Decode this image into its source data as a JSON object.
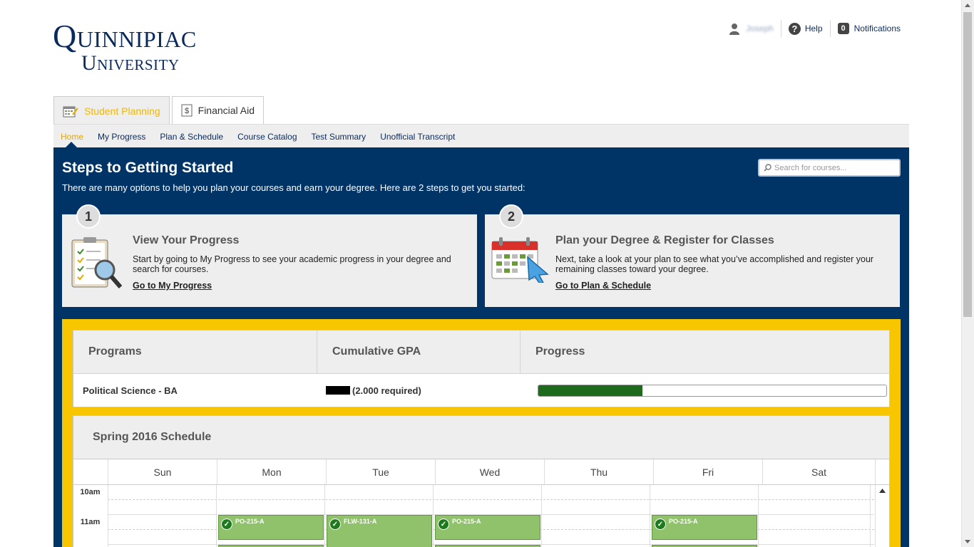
{
  "logo": {
    "line1": "Quinnipiac",
    "line2": "University"
  },
  "header": {
    "user_name": "Joseph",
    "help_label": "Help",
    "notifications_count": "0",
    "notifications_label": "Notifications"
  },
  "tabs": [
    {
      "label": "Student Planning",
      "active": true
    },
    {
      "label": "Financial Aid",
      "active": false
    }
  ],
  "subnav": [
    "Home",
    "My Progress",
    "Plan & Schedule",
    "Course Catalog",
    "Test Summary",
    "Unofficial Transcript"
  ],
  "steps": {
    "title": "Steps to Getting Started",
    "subtitle": "There are many options to help you plan your courses and earn your degree. Here are 2 steps to get you started:",
    "search_placeholder": "Search for courses...",
    "cards": [
      {
        "number": "1",
        "title": "View Your Progress",
        "text": "Start by going to My Progress to see your academic progress in your degree and search for courses.",
        "link": "Go to My Progress"
      },
      {
        "number": "2",
        "title": "Plan your Degree & Register for Classes",
        "text": "Next, take a look at your plan to see what you’ve accomplished and register your remaining classes toward your degree.",
        "link": "Go to Plan & Schedule"
      }
    ]
  },
  "programs": {
    "headers": [
      "Programs",
      "Cumulative GPA",
      "Progress"
    ],
    "rows": [
      {
        "program": "Political Science - BA",
        "gpa_required": "(2.000 required)",
        "progress_fraction": 0.3
      }
    ]
  },
  "schedule": {
    "title": "Spring 2016 Schedule",
    "days": [
      "Sun",
      "Mon",
      "Tue",
      "Wed",
      "Thu",
      "Fri",
      "Sat"
    ],
    "hours": [
      "10am",
      "11am"
    ],
    "events": [
      {
        "day_index": 1,
        "label": "PO-215-A"
      },
      {
        "day_index": 2,
        "label": "FLW-131-A"
      },
      {
        "day_index": 3,
        "label": "PO-215-A"
      },
      {
        "day_index": 5,
        "label": "PO-215-A"
      }
    ]
  },
  "colors": {
    "navy": "#003366",
    "gold": "#f7c600",
    "accent": "#e8a800",
    "event_green": "#90c26b",
    "progress_green": "#1d6a1d"
  }
}
